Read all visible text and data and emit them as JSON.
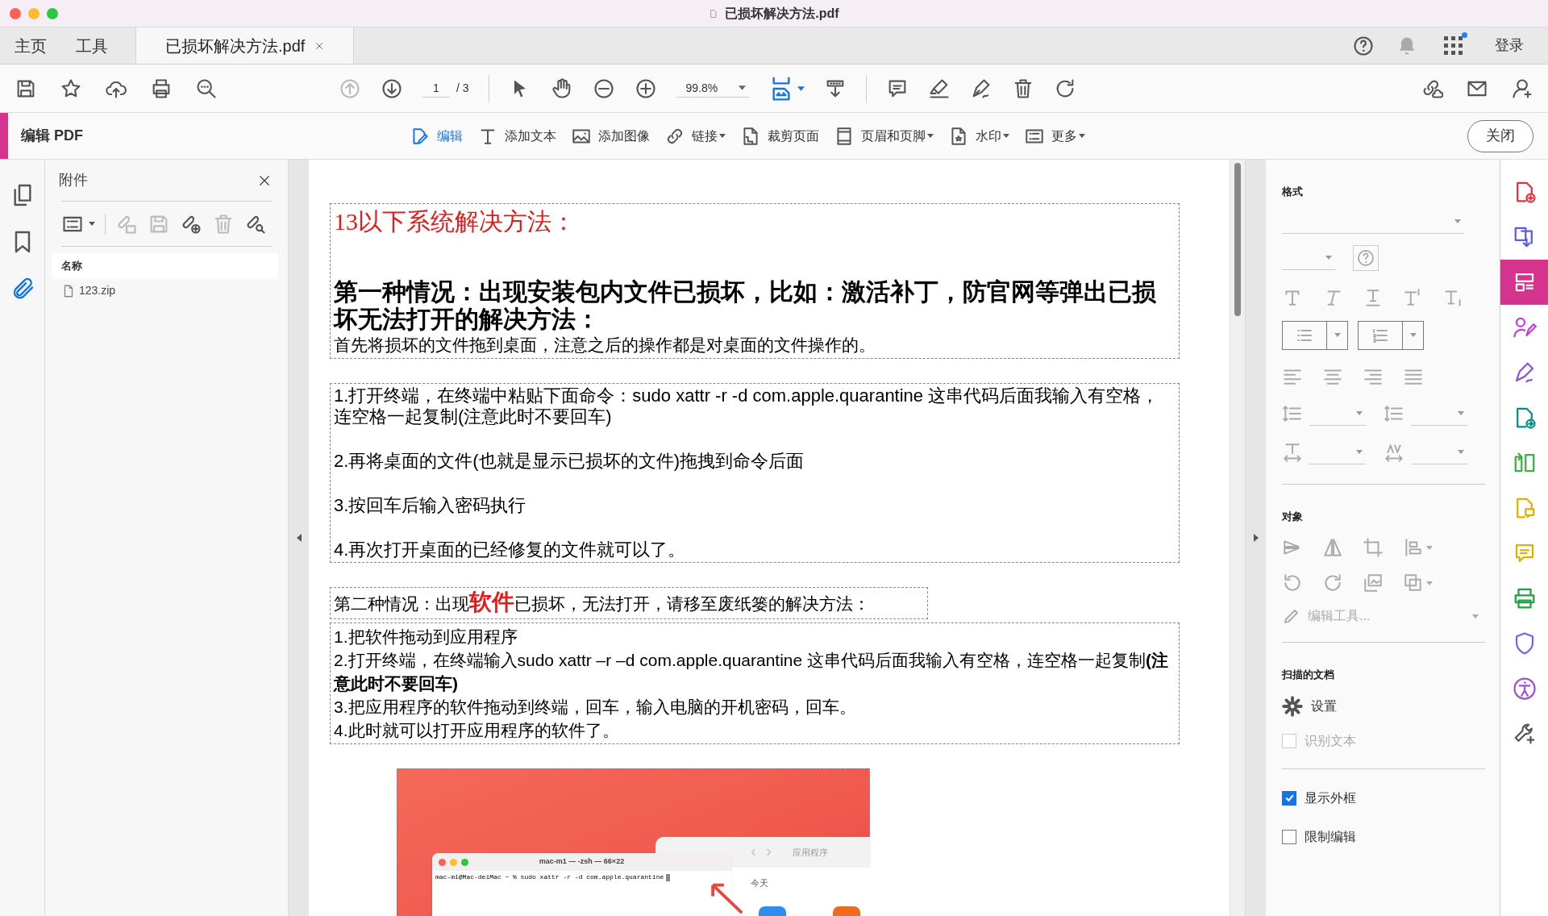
{
  "window": {
    "title": "已损坏解决方法.pdf"
  },
  "nav_tabs": [
    {
      "label": "主页",
      "selected": false
    },
    {
      "label": "工具",
      "selected": false
    },
    {
      "label": "已损坏解决方法.pdf",
      "selected": true,
      "closable": true
    }
  ],
  "account": {
    "sign_in": "登录",
    "notification_dot": true
  },
  "toolbar": {
    "page": "1",
    "page_total": "/ 3",
    "zoom": "99.8%",
    "prev_page_disabled": true
  },
  "edit_bar": {
    "title": "编辑 PDF",
    "close": "关闭",
    "tools": [
      {
        "label": "编辑",
        "selected": true,
        "menu": false
      },
      {
        "label": "添加文本",
        "selected": false,
        "menu": false
      },
      {
        "label": "添加图像",
        "selected": false,
        "menu": false
      },
      {
        "label": "链接",
        "selected": false,
        "menu": true
      },
      {
        "label": "裁剪页面",
        "selected": false,
        "menu": false
      },
      {
        "label": "页眉和页脚",
        "selected": false,
        "menu": true
      },
      {
        "label": "水印",
        "selected": false,
        "menu": true
      },
      {
        "label": "更多",
        "selected": false,
        "menu": true
      }
    ]
  },
  "left_rail": [
    {
      "selected": false
    },
    {
      "selected": false
    },
    {
      "selected": true
    }
  ],
  "attachments": {
    "title": "附件",
    "column": "名称",
    "tools": [
      {
        "disabled": false
      },
      {
        "disabled": true
      },
      {
        "disabled": true
      },
      {
        "disabled": false
      },
      {
        "disabled": true
      },
      {
        "disabled": false
      }
    ],
    "files": [
      {
        "name": "123.zip"
      }
    ]
  },
  "document": {
    "blocks": [
      {
        "kind": "box",
        "paragraphs": [
          {
            "kind": "title",
            "text": "13以下系统解决方法："
          },
          {
            "kind": "heading",
            "text": "第一种情况：出现安装包内文件已损坏，比如：激活补丁，防官网等弹出已损坏无法打开的解决方法："
          },
          {
            "kind": "body",
            "text": "首先将损坏的文件拖到桌面，注意之后的操作都是对桌面的文件操作的。"
          }
        ]
      },
      {
        "kind": "box",
        "paragraphs": [
          {
            "kind": "step",
            "text": "1.打开终端，在终端中粘贴下面命令：sudo xattr -r -d com.apple.quarantine 这串代码后面我输入有空格，连空格一起复制(注意此时不要回车)"
          },
          {
            "kind": "step",
            "text": "2.再将桌面的文件(也就是显示已损坏的文件)拖拽到命令后面"
          },
          {
            "kind": "step",
            "text": "3.按回车后输入密码执行"
          },
          {
            "kind": "step",
            "text": "4.再次打开桌面的已经修复的文件就可以了。"
          }
        ]
      },
      {
        "kind": "box",
        "paragraphs": [
          {
            "kind": "mixed",
            "parts": [
              {
                "text": "第二种情况：出现",
                "emphasis": false
              },
              {
                "text": "软件",
                "emphasis": true
              },
              {
                "text": "已损坏，无法打开，请移至废纸篓的解决方法：",
                "emphasis": false
              }
            ]
          }
        ]
      },
      {
        "kind": "box",
        "paragraphs": [
          {
            "kind": "body",
            "text": "1.把软件拖动到应用程序"
          },
          {
            "kind": "body",
            "text": "2.打开终端，在终端输入sudo xattr –r –d com.apple.quarantine 这串代码后面我输入有空格，连空格一起复制**(注意此时不要回车)**"
          },
          {
            "kind": "body",
            "text": "3.把应用程序的软件拖动到终端，回车，输入电脑的开机密码，回车。"
          },
          {
            "kind": "body",
            "text": "4.此时就可以打开应用程序的软件了。"
          }
        ]
      },
      {
        "kind": "screenshot",
        "terminal_title": "mac-m1 — -zsh — 66×22",
        "terminal_line": "mac-m1@Mac-deiMac ~ % sudo xattr -r -d com.apple.quarantine",
        "finder_title": "应用程序",
        "finder_section": "今天"
      }
    ]
  },
  "format": {
    "title": "格式",
    "disabled": true
  },
  "object": {
    "title": "对象",
    "disabled": true,
    "edit_tools": "编辑工具..."
  },
  "scanned": {
    "title": "扫描的文档",
    "settings": "设置",
    "ocr": {
      "label": "识别文本",
      "checked": false,
      "disabled": true
    }
  },
  "options": [
    {
      "label": "显示外框",
      "checked": true
    },
    {
      "label": "限制编辑",
      "checked": false
    }
  ],
  "right_rail": [
    {
      "selected": false
    },
    {
      "selected": false
    },
    {
      "selected": true
    },
    {
      "selected": false
    },
    {
      "selected": false
    },
    {
      "selected": false
    },
    {
      "selected": false
    },
    {
      "selected": false
    },
    {
      "selected": false
    },
    {
      "selected": false
    },
    {
      "selected": false
    },
    {
      "selected": false
    },
    {
      "selected": false
    }
  ]
}
